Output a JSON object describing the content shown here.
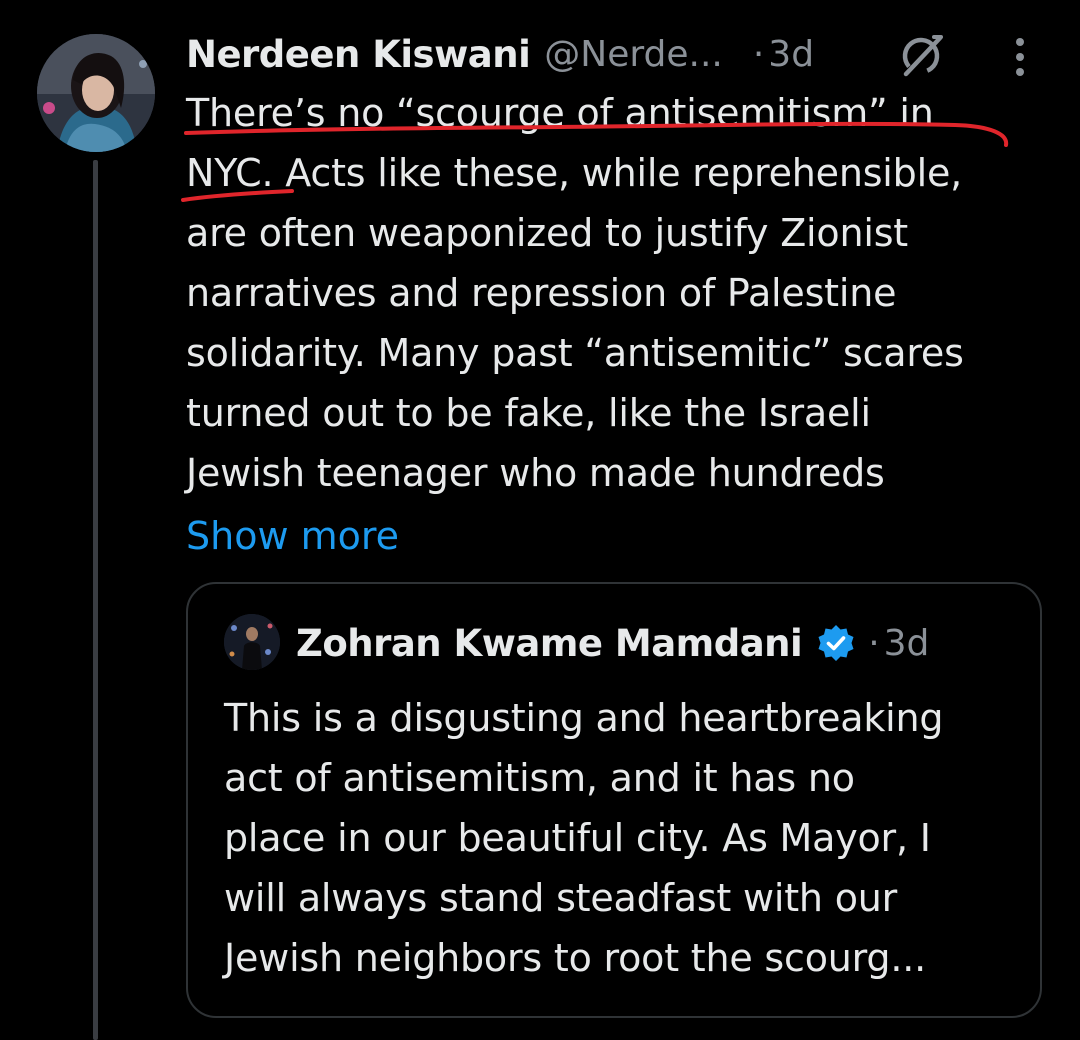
{
  "tweet": {
    "author_name": "Nerdeen Kiswani",
    "author_handle": "@Nerde...",
    "separator": "·",
    "time": "3d",
    "text_lines": [
      "There’s no “scourge of antisemitism” in",
      "NYC. Acts like these, while reprehensible,",
      "are often weaponized to justify Zionist",
      "narratives and repression of Palestine",
      "solidarity. Many past “antisemitic” scares",
      "turned out to be fake, like the Israeli",
      "Jewish teenager who made hundreds"
    ],
    "show_more_label": "Show more"
  },
  "quote": {
    "author_name": "Zohran Kwame Mamdani",
    "separator": "·",
    "time": "3d",
    "text_lines": [
      "This is a disgusting and heartbreaking",
      "act of antisemitism, and it has no",
      "place in our beautiful city. As Mayor, I",
      "will always stand steadfast with our",
      "Jewish neighbors to root the scourg..."
    ]
  },
  "icons": {
    "grok": "grok-icon",
    "more": "more-vertical-icon",
    "verified": "verified-badge-icon"
  },
  "colors": {
    "background": "#000000",
    "text": "#e7e9ea",
    "secondary_text": "#8b9198",
    "link": "#1d9bf0",
    "verified": "#1d9bf0",
    "annotation_red": "#e0252b",
    "border": "#2f3336"
  }
}
